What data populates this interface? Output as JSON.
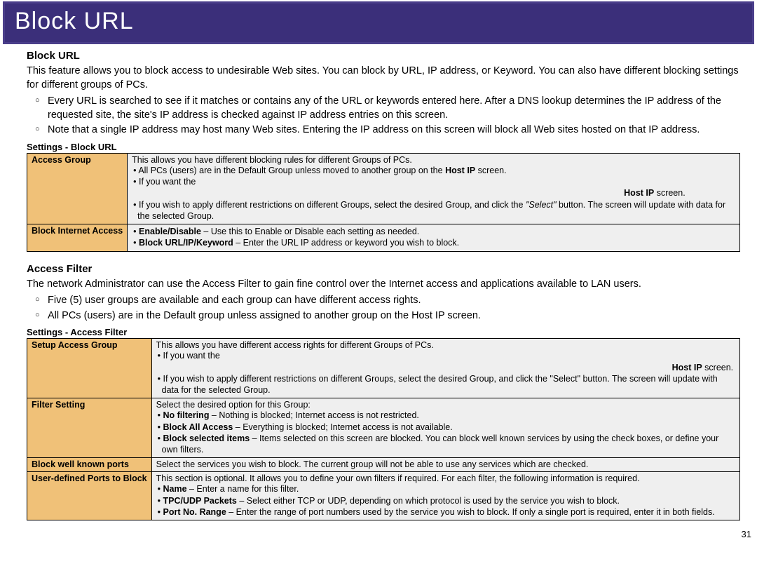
{
  "banner": {
    "title": "Block URL"
  },
  "blockurl": {
    "heading": "Block URL",
    "intro": "This feature allows you to block access to undesirable Web sites. You can block by URL, IP address, or Keyword.  You can also have different blocking settings for different groups of PCs.",
    "b1": "Every URL is searched to see if it matches or contains any of the URL or keywords entered here. After a DNS lookup determines the IP address of the requested site, the site's IP address is checked against IP address entries on this screen.",
    "b2": "Note that a single IP address may host many Web sites. Entering the IP address on this screen will block all Web sites hosted on that IP address.",
    "tableTitle": "Settings - Block URL",
    "row1": {
      "label": "Access Group",
      "line1": "This allows you have different blocking rules for different Groups of PCs.",
      "li1a": "All PCs (users) are in the Default Group unless moved to another group on the ",
      "li1b": "Host IP",
      "li1c": " screen.",
      "li2a": "If you want the",
      "li2b": "Host IP",
      "li2c": " screen.",
      "li3a": "If you wish to apply different restrictions on different Groups, select the desired Group, and click the ",
      "li3b": "\"Select\"",
      "li3c": " button. The screen will update with data for the selected Group."
    },
    "row2": {
      "label": "Block Internet Access",
      "li1a": "Enable/Disable",
      "li1b": " – Use this to Enable or Disable each setting as needed.",
      "li2a": "Block URL/IP/Keyword",
      "li2b": " – Enter the URL IP address or keyword you wish to block."
    }
  },
  "access": {
    "heading": "Access Filter",
    "intro": "The network Administrator can use the Access Filter to gain fine control over the Internet access and applications available to LAN users.",
    "b1": "Five (5) user groups are available and each group can have different access rights.",
    "b2": "All PCs (users) are in the Default group unless assigned to another group on the Host IP screen.",
    "tableTitle": "Settings - Access Filter",
    "row1": {
      "label": "Setup Access Group",
      "line1": "This allows you have different access rights for different Groups of PCs.",
      "li1a": "If you want the",
      "li1b": "Host IP",
      "li1c": " screen.",
      "li2": "If you wish to apply different restrictions on different Groups, select the desired Group, and click the \"Select\" button. The screen will update with data for the selected Group."
    },
    "row2": {
      "label": "Filter Setting",
      "line1": "Select the desired option for this Group:",
      "li1a": "No filtering",
      "li1b": " – Nothing is blocked; Internet access is not restricted.",
      "li2a": "Block All Access",
      "li2b": " – Everything is blocked; Internet access is not available.",
      "li3a": "Block selected items",
      "li3b": " – Items selected on this screen are blocked. You can block well known services by using the check boxes, or define your own filters."
    },
    "row3": {
      "label": "Block well known ports",
      "line1": "Select the services you wish to block. The current group will not be able to use any services which are checked."
    },
    "row4": {
      "label": "User-defined Ports to Block",
      "line1": "This section is optional. It allows you to define your own filters if required. For each filter, the following information is required.",
      "li1a": "Name",
      "li1b": " – Enter a name for this filter.",
      "li2a": "TPC/UDP Packets",
      "li2b": " – Select either TCP or UDP, depending on which protocol is used by the service you wish to block.",
      "li3a": "Port No. Range",
      "li3b": " – Enter the range of port numbers used by the service you wish to block. If only a single port is required, enter it in both fields."
    }
  },
  "page": "31"
}
